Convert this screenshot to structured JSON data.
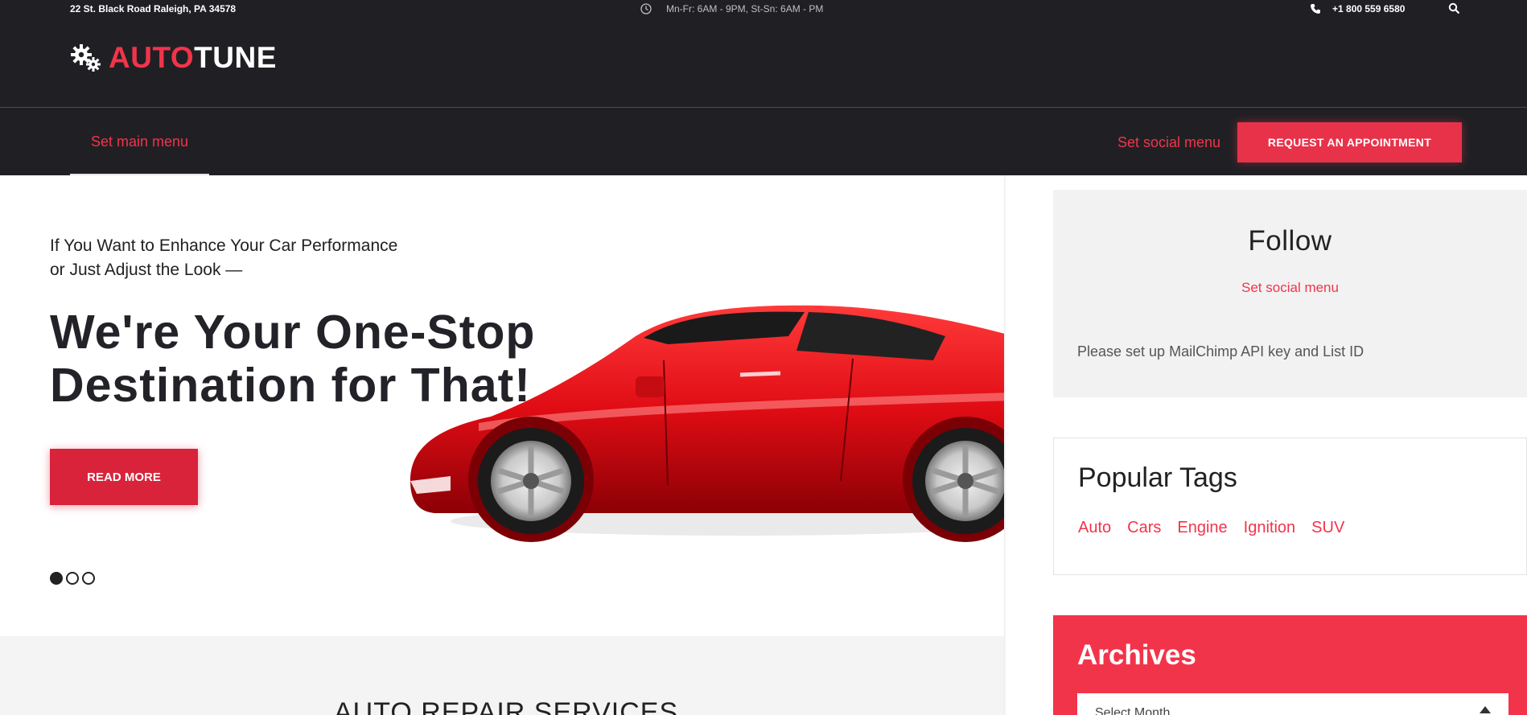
{
  "topbar": {
    "address": "22 St. Black Road Raleigh, PA 34578",
    "hours": "Mn-Fr: 6AM - 9PM, St-Sn: 6AM - PM",
    "phone": "+1 800 559 6580"
  },
  "logo": {
    "part1": "AUTO",
    "part2": "TUNE"
  },
  "nav": {
    "main_menu": "Set main menu",
    "social_menu": "Set social menu",
    "appointment_button": "REQUEST AN APPOINTMENT"
  },
  "hero": {
    "subtitle": "If You Want to Enhance Your Car Performance or Just Adjust the Look —",
    "title": "We're Your One-Stop Destination for That!",
    "button": "READ MORE",
    "slides": 3,
    "active_slide": 1
  },
  "services": {
    "title": "AUTO REPAIR SERVICES"
  },
  "sidebar": {
    "follow": {
      "title": "Follow",
      "social_menu": "Set social menu",
      "mailchimp_notice": "Please set up MailChimp API key and List ID"
    },
    "tags": {
      "title": "Popular Tags",
      "items": [
        "Auto",
        "Cars",
        "Engine",
        "Ignition",
        "SUV"
      ]
    },
    "archives": {
      "title": "Archives",
      "select_placeholder": "Select Month"
    }
  },
  "colors": {
    "accent": "#f2344a",
    "header_bg": "#202024",
    "dark_text": "#222228"
  },
  "icons": [
    "gears-icon",
    "clock-icon",
    "phone-icon",
    "search-icon",
    "car-image"
  ]
}
